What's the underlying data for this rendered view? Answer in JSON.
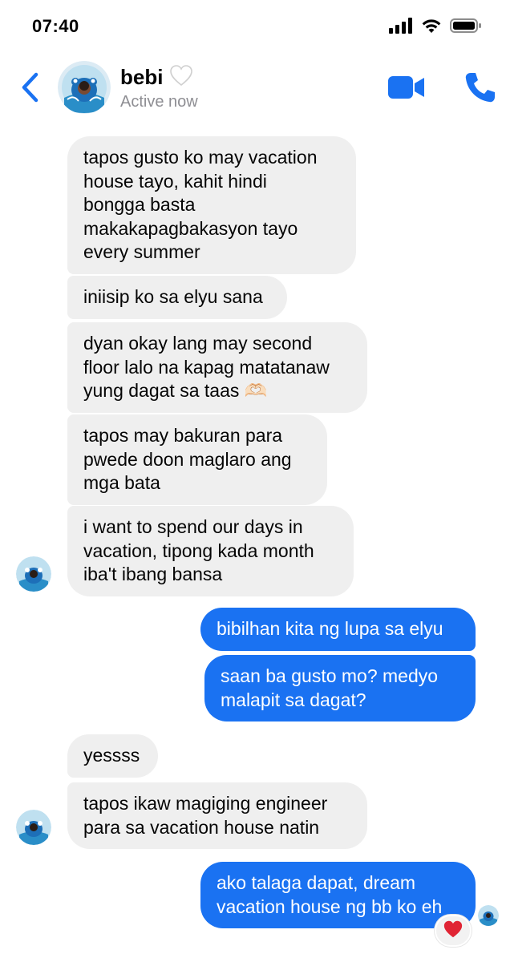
{
  "status_bar": {
    "time": "07:40"
  },
  "header": {
    "name": "bebi",
    "name_emoji": "heart-icon",
    "status": "Active now",
    "accent_color": "#1a72f2"
  },
  "messages": [
    {
      "direction": "incoming",
      "text": "tapos gusto ko may vacation\nhouse tayo, kahit hindi\nbongga basta\nmakakapagbakasyon tayo\nevery summer"
    },
    {
      "direction": "incoming",
      "text": "iniisip ko sa elyu sana"
    },
    {
      "direction": "incoming",
      "text": "dyan okay lang may second\nfloor lalo na kapag matatanaw\nyung dagat sa taas 🫶🏻"
    },
    {
      "direction": "incoming",
      "text": "tapos may bakuran para\npwede doon maglaro ang\nmga bata"
    },
    {
      "direction": "incoming",
      "text": "i want to spend our days in\nvacation, tipong kada month\niba't ibang bansa"
    },
    {
      "direction": "outgoing",
      "text": "bibilhan kita ng lupa sa elyu"
    },
    {
      "direction": "outgoing",
      "text": "saan ba gusto mo? medyo\nmalapit sa dagat?"
    },
    {
      "direction": "incoming",
      "text": "yessss"
    },
    {
      "direction": "incoming",
      "text": "tapos ikaw magiging engineer\npara sa vacation house natin"
    },
    {
      "direction": "outgoing",
      "text": "ako talaga dapat, dream\nvacation house ng bb ko eh"
    }
  ],
  "reaction": {
    "emoji": "red-heart-icon"
  },
  "colors": {
    "incoming_bubble": "#efefef",
    "outgoing_bubble": "#1a72f2"
  }
}
